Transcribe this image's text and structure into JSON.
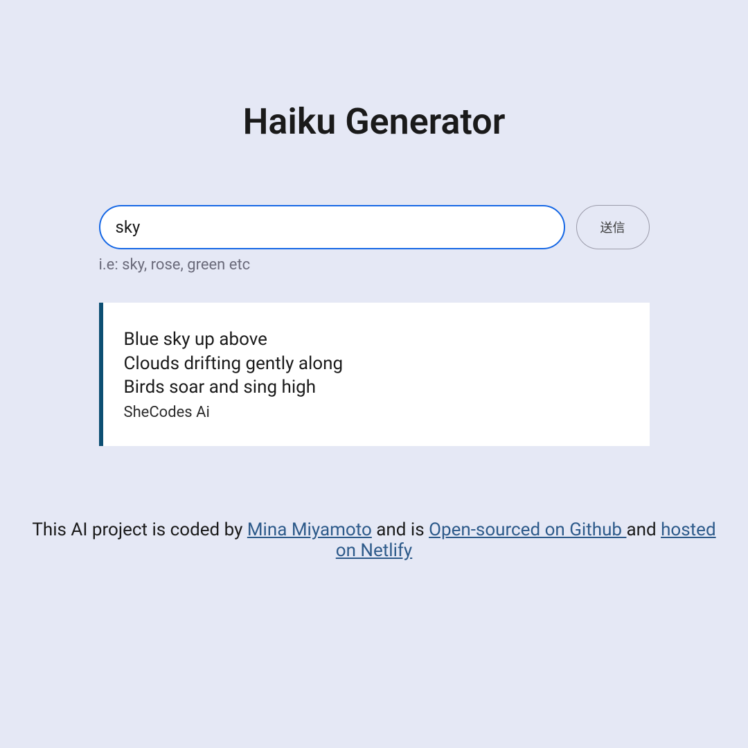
{
  "title": "Haiku Generator",
  "form": {
    "input_value": "sky",
    "input_placeholder": "",
    "submit_label": "送信",
    "hint": "i.e: sky, rose, green etc"
  },
  "haiku": {
    "lines": [
      "Blue sky up above",
      "Clouds drifting gently along",
      "Birds soar and sing high"
    ],
    "attribution": "SheCodes Ai"
  },
  "footer": {
    "prefix": "This AI project is coded by ",
    "author_link": "Mina Miyamoto",
    "mid1": " and is ",
    "github_link": "Open-sourced on Github ",
    "mid2": "and ",
    "netlify_link": "hosted on Netlify"
  }
}
